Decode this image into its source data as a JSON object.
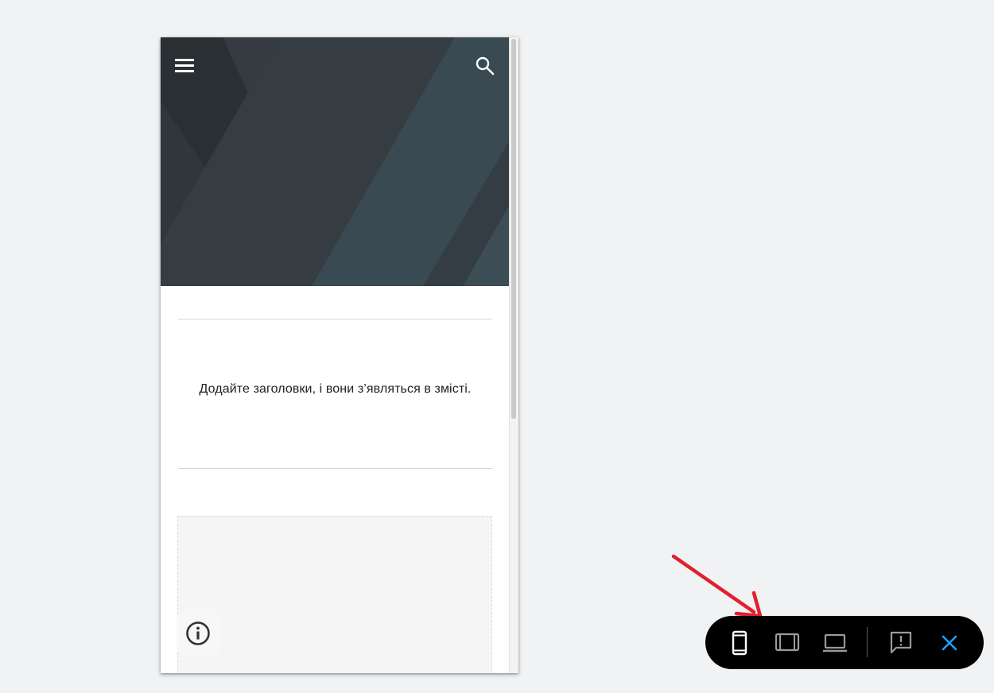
{
  "preview": {
    "hero": {
      "menu_icon": "hamburger-menu-icon",
      "search_icon": "search-icon"
    },
    "toc_placeholder_text": "Додайте заголовки, і вони з’являться в змісті.",
    "info_icon": "info-icon"
  },
  "toolbar": {
    "buttons": [
      {
        "name": "phone-view",
        "icon": "phone-icon",
        "selected": true
      },
      {
        "name": "tablet-view",
        "icon": "tablet-icon",
        "selected": false
      },
      {
        "name": "laptop-view",
        "icon": "laptop-icon",
        "selected": false
      },
      {
        "name": "feedback",
        "icon": "report-issue-icon",
        "selected": false
      },
      {
        "name": "close",
        "icon": "close-icon",
        "selected": false
      }
    ]
  },
  "colors": {
    "page_bg": "#f1f2f4",
    "hero_dark": "#2f3438",
    "hero_teal": "#3a4a53",
    "toolbar_bg": "#000000",
    "close_accent": "#1aa3ff",
    "arrow": "#e0202e"
  }
}
